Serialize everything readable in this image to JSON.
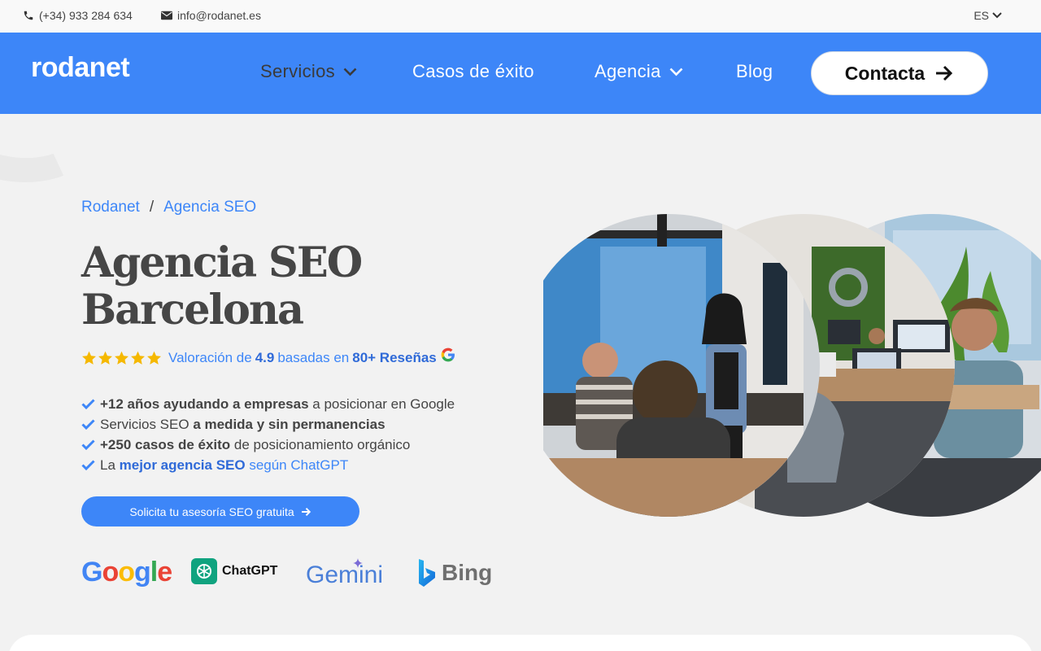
{
  "topbar": {
    "phone": "(+34) 933 284 634",
    "email": "info@rodanet.es",
    "lang": "ES"
  },
  "nav": {
    "logo": "rodanet",
    "links": [
      "Servicios",
      "Casos de éxito",
      "Agencia",
      "Blog"
    ],
    "cta": "Contacta"
  },
  "breadcrumb": [
    "Rodanet",
    "/",
    "Agencia SEO"
  ],
  "hero": {
    "title_line1": "Agencia SEO",
    "title_line2": "Barcelona",
    "rating_prefix": "Valoración de",
    "rating_value": "4.9",
    "rating_mid": "basadas en",
    "rating_reviews": "80+ Reseñas",
    "rating_stars": 5,
    "bullets": [
      {
        "bold": "+12 años ayudando a empresas",
        "rest": " a posicionar en Google"
      },
      {
        "pre": "Servicios SEO ",
        "bold": "a medida y sin permanencias"
      },
      {
        "bold": "+250 casos de éxito",
        "rest": " de posicionamiento orgánico"
      },
      {
        "pre": "La ",
        "bold": "mejor agencia SEO",
        "rest": " según ChatGPT"
      }
    ],
    "button": "Solicita tu asesoría SEO gratuita"
  },
  "brands": [
    "Google",
    "ChatGPT",
    "Gemini",
    "Bing"
  ],
  "colors": {
    "brand_blue": "#3d86f8",
    "heading": "#464646",
    "star": "#f5b800"
  }
}
